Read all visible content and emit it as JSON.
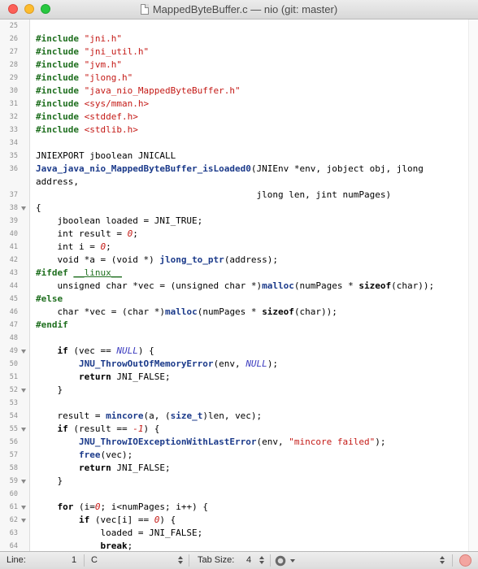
{
  "window": {
    "title": "MappedByteBuffer.c — nio (git: master)"
  },
  "editor": {
    "lines": [
      {
        "n": "25",
        "fold": false,
        "html": ""
      },
      {
        "n": "26",
        "fold": false,
        "html": "<span class=\"pp\">#include</span> <span class=\"str\">\"jni.h\"</span>"
      },
      {
        "n": "27",
        "fold": false,
        "html": "<span class=\"pp\">#include</span> <span class=\"str\">\"jni_util.h\"</span>"
      },
      {
        "n": "28",
        "fold": false,
        "html": "<span class=\"pp\">#include</span> <span class=\"str\">\"jvm.h\"</span>"
      },
      {
        "n": "29",
        "fold": false,
        "html": "<span class=\"pp\">#include</span> <span class=\"str\">\"jlong.h\"</span>"
      },
      {
        "n": "30",
        "fold": false,
        "html": "<span class=\"pp\">#include</span> <span class=\"str\">\"java_nio_MappedByteBuffer.h\"</span>"
      },
      {
        "n": "31",
        "fold": false,
        "html": "<span class=\"pp\">#include</span> <span class=\"str\">&lt;sys/mman.h&gt;</span>"
      },
      {
        "n": "32",
        "fold": false,
        "html": "<span class=\"pp\">#include</span> <span class=\"str\">&lt;stddef.h&gt;</span>"
      },
      {
        "n": "33",
        "fold": false,
        "html": "<span class=\"pp\">#include</span> <span class=\"str\">&lt;stdlib.h&gt;</span>"
      },
      {
        "n": "34",
        "fold": false,
        "html": ""
      },
      {
        "n": "35",
        "fold": false,
        "html": "JNIEXPORT jboolean JNICALL"
      },
      {
        "n": "36",
        "fold": false,
        "html": "<span class=\"fn\">Java_java_nio_MappedByteBuffer_isLoaded0</span>(JNIEnv *env, jobject obj, jlong"
      },
      {
        "n": "",
        "fold": false,
        "html": "address,"
      },
      {
        "n": "37",
        "fold": false,
        "html": "                                         jlong len, jint numPages)"
      },
      {
        "n": "38",
        "fold": true,
        "html": "{"
      },
      {
        "n": "39",
        "fold": false,
        "html": "    jboolean loaded = JNI_TRUE;"
      },
      {
        "n": "40",
        "fold": false,
        "html": "    int result = <span class=\"num\">0</span>;"
      },
      {
        "n": "41",
        "fold": false,
        "html": "    int i = <span class=\"num\">0</span>;"
      },
      {
        "n": "42",
        "fold": false,
        "html": "    void *a = (void *) <span class=\"fn\">jlong_to_ptr</span>(address);"
      },
      {
        "n": "43",
        "fold": false,
        "html": "<span class=\"pp\">#ifdef</span> <span class=\"und\">__linux__</span>"
      },
      {
        "n": "44",
        "fold": false,
        "html": "    unsigned char *vec = (unsigned char *)<span class=\"fn\">malloc</span>(numPages * <span class=\"kw\">sizeof</span>(char));"
      },
      {
        "n": "45",
        "fold": false,
        "html": "<span class=\"pp\">#else</span>"
      },
      {
        "n": "46",
        "fold": false,
        "html": "    char *vec = (char *)<span class=\"fn\">malloc</span>(numPages * <span class=\"kw\">sizeof</span>(char));"
      },
      {
        "n": "47",
        "fold": false,
        "html": "<span class=\"pp\">#endif</span>"
      },
      {
        "n": "48",
        "fold": false,
        "html": ""
      },
      {
        "n": "49",
        "fold": true,
        "html": "    <span class=\"kw\">if</span> (vec == <span class=\"lit\">NULL</span>) {"
      },
      {
        "n": "50",
        "fold": false,
        "html": "        <span class=\"fn\">JNU_ThrowOutOfMemoryError</span>(env, <span class=\"lit\">NULL</span>);"
      },
      {
        "n": "51",
        "fold": false,
        "html": "        <span class=\"kw\">return</span> JNI_FALSE;"
      },
      {
        "n": "52",
        "fold": true,
        "html": "    }"
      },
      {
        "n": "53",
        "fold": false,
        "html": ""
      },
      {
        "n": "54",
        "fold": false,
        "html": "    result = <span class=\"fn\">mincore</span>(a, (<span class=\"fn\">size_t</span>)len, vec);"
      },
      {
        "n": "55",
        "fold": true,
        "html": "    <span class=\"kw\">if</span> (result == <span class=\"num\">-1</span>) {"
      },
      {
        "n": "56",
        "fold": false,
        "html": "        <span class=\"fn\">JNU_ThrowIOExceptionWithLastError</span>(env, <span class=\"str\">\"mincore failed\"</span>);"
      },
      {
        "n": "57",
        "fold": false,
        "html": "        <span class=\"fn\">free</span>(vec);"
      },
      {
        "n": "58",
        "fold": false,
        "html": "        <span class=\"kw\">return</span> JNI_FALSE;"
      },
      {
        "n": "59",
        "fold": true,
        "html": "    }"
      },
      {
        "n": "60",
        "fold": false,
        "html": ""
      },
      {
        "n": "61",
        "fold": true,
        "html": "    <span class=\"kw\">for</span> (i=<span class=\"num\">0</span>; i&lt;numPages; i++) {"
      },
      {
        "n": "62",
        "fold": true,
        "html": "        <span class=\"kw\">if</span> (vec[i] == <span class=\"num\">0</span>) {"
      },
      {
        "n": "63",
        "fold": false,
        "html": "            loaded = JNI_FALSE;"
      },
      {
        "n": "64",
        "fold": false,
        "html": "            <span class=\"kw\">break</span>;"
      }
    ]
  },
  "statusbar": {
    "line_label": "Line:",
    "line_value": "1",
    "language": "C",
    "tab_size_label": "Tab Size:",
    "tab_size_value": "4"
  },
  "icons": {
    "close": "close-icon",
    "minimize": "minimize-icon",
    "zoom": "zoom-icon",
    "document": "document-icon",
    "gear": "gear-icon",
    "record": "record-icon"
  },
  "colors": {
    "preprocessor": "#1f6f1f",
    "function": "#1b3a8a",
    "string": "#c41a16",
    "literal": "#3b3bbf"
  }
}
